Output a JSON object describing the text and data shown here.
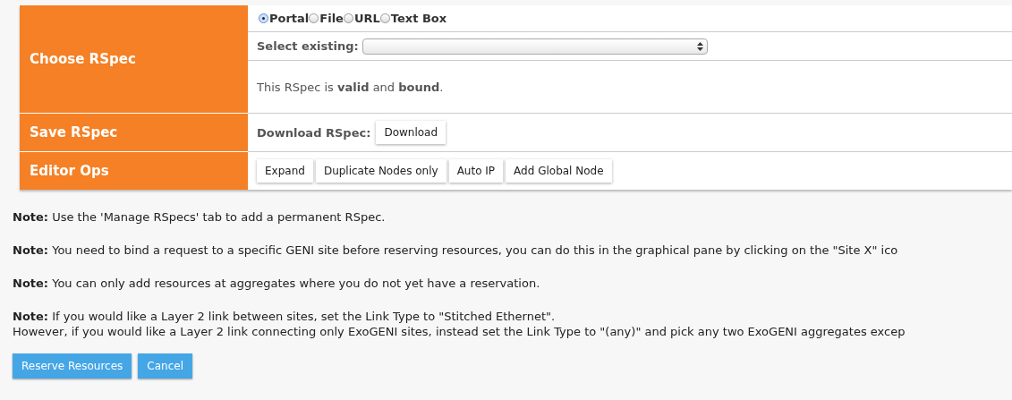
{
  "choose_rspec": {
    "label": "Choose RSpec",
    "sources": [
      {
        "label": "Portal",
        "selected": true
      },
      {
        "label": "File",
        "selected": false
      },
      {
        "label": "URL",
        "selected": false
      },
      {
        "label": "Text Box",
        "selected": false
      }
    ],
    "select_label": "Select existing:",
    "status": "This RSpec is **valid** and **bound**."
  },
  "save_rspec": {
    "label": "Save RSpec",
    "download_label": "Download RSpec:",
    "button": "Download"
  },
  "editor_ops": {
    "label": "Editor Ops",
    "buttons": [
      "Expand",
      "Duplicate Nodes only",
      "Auto IP",
      "Add Global Node"
    ]
  },
  "notes": [
    {
      "lines": [
        "**Note:** Use the 'Manage RSpecs' tab to add a permanent RSpec."
      ]
    },
    {
      "lines": [
        "**Note:** You need to bind a request to a specific GENI site before reserving resources, you can do this in the graphical pane by clicking on the \"Site X\" ico"
      ]
    },
    {
      "lines": [
        "**Note:** You can only add resources at aggregates where you do not yet have a reservation."
      ]
    },
    {
      "lines": [
        "**Note:** If you would like a Layer 2 link between sites, set the Link Type to \"Stitched Ethernet\".",
        "However, if you would like a Layer 2 link connecting only ExoGENI sites, instead set the Link Type to \"(any)\" and pick any two ExoGENI aggregates excep"
      ]
    }
  ],
  "actions": [
    "Reserve Resources",
    "Cancel"
  ]
}
